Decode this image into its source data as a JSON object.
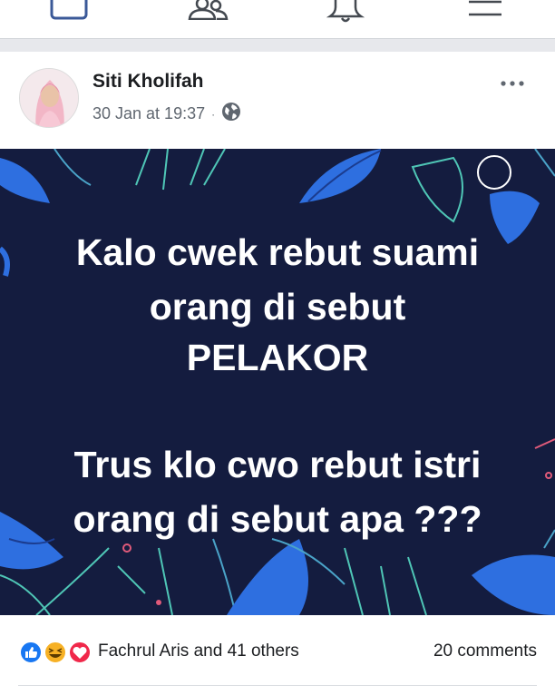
{
  "nav": {
    "icons": [
      "news-feed-icon",
      "friends-icon",
      "notifications-icon",
      "menu-icon"
    ]
  },
  "post": {
    "author": "Siti Kholifah",
    "timestamp": "30 Jan at 19:37",
    "separator": "·",
    "privacy_icon": "globe-icon",
    "more_icon": "more-options-icon",
    "text_lines": [
      "Kalo cwek rebut suami",
      "orang di sebut",
      "PELAKOR",
      "Trus klo cwo rebut istri",
      "orang di sebut apa ???"
    ],
    "background_color": "#141c3f"
  },
  "reactions": {
    "icons": [
      "like-reaction-icon",
      "haha-reaction-icon",
      "love-reaction-icon"
    ],
    "likers_text": "Fachrul Aris and 41 others",
    "comments_text": "20 comments"
  }
}
